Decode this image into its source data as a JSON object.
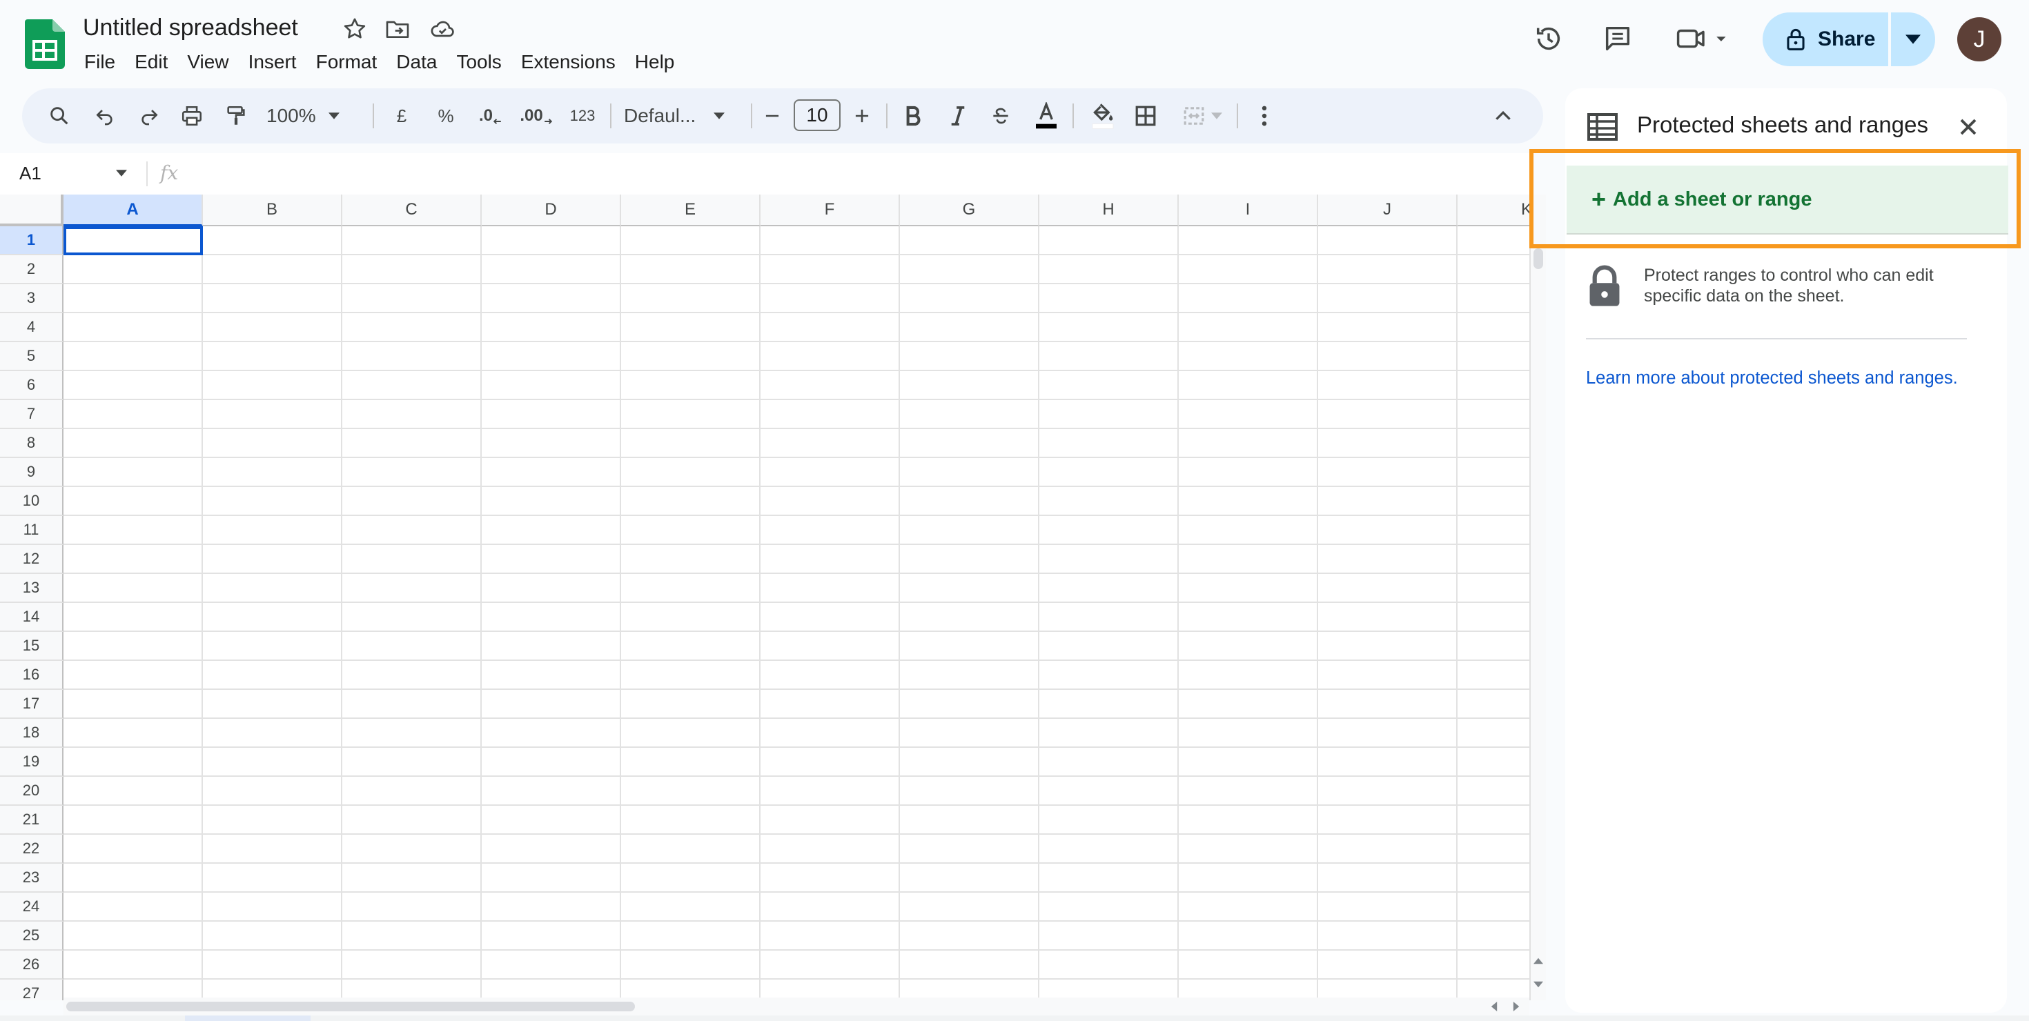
{
  "app": {
    "title": "Untitled spreadsheet",
    "avatar_initial": "J",
    "share_label": "Share"
  },
  "menu": [
    "File",
    "Edit",
    "View",
    "Insert",
    "Format",
    "Data",
    "Tools",
    "Extensions",
    "Help"
  ],
  "toolbar": {
    "zoom": "100%",
    "currency": "£",
    "percent": "%",
    "decrease_decimal": ".0",
    "increase_decimal": ".00",
    "number_format": "123",
    "font": "Defaul...",
    "font_size": "10"
  },
  "formula_bar": {
    "cell_ref": "A1",
    "fx": "fx"
  },
  "grid": {
    "columns": [
      "A",
      "B",
      "C",
      "D",
      "E",
      "F",
      "G",
      "H",
      "I",
      "J",
      "K"
    ],
    "rows": [
      "1",
      "2",
      "3",
      "4",
      "5",
      "6",
      "7",
      "8",
      "9",
      "10",
      "11",
      "12",
      "13",
      "14",
      "15",
      "16",
      "17",
      "18",
      "19",
      "20",
      "21",
      "22",
      "23",
      "24",
      "25",
      "26",
      "27"
    ],
    "active_column": "A",
    "active_row": "1"
  },
  "panel": {
    "title": "Protected sheets and ranges",
    "add_label": "Add a sheet or range",
    "add_plus": "+",
    "description": "Protect ranges to control who can edit specific data on the sheet.",
    "learn_more": "Learn more about protected sheets and ranges."
  },
  "colors": {
    "accent_blue": "#0b57d0",
    "share_bg": "#c2e7ff",
    "add_range_bg": "#e6f4ea",
    "add_range_text": "#137333",
    "highlight_orange": "#f7981d",
    "sheets_green": "#0f9d58"
  }
}
